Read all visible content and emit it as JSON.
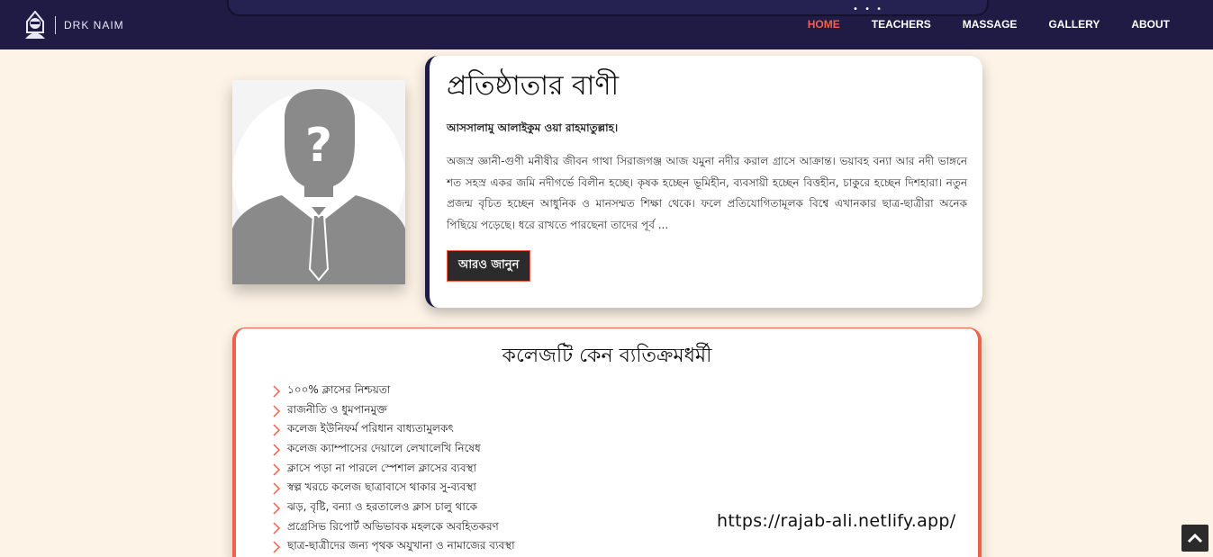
{
  "brand": {
    "name": "DRK NAIM",
    "icon": "hacker-icon"
  },
  "nav": {
    "dots": "• • •",
    "items": [
      {
        "label": "HOME",
        "active": true
      },
      {
        "label": "TEACHERS",
        "active": false
      },
      {
        "label": "MASSAGE",
        "active": false
      },
      {
        "label": "GALLERY",
        "active": false
      },
      {
        "label": "ABOUT",
        "active": false
      }
    ]
  },
  "founder": {
    "title": "প্রতিষ্ঠাতার বাণী",
    "greeting": "আসসালামু আলাইকুম ওয়া রাহমাতুল্লাহ।",
    "body": "অজস্র জ্ঞানী-গুণী মনীষীর জীবন গাথা সিরাজগঞ্জ আজ যমুনা নদীর করাল গ্রাসে আক্রান্ত। ভয়াবহ বন্যা আর নদী ভাঙ্গনে শত সহস্র একর জমি নদীগর্ভে বিলীন হচ্ছে। কৃষক হচ্ছেন ভূমিহীন, ব্যবসায়ী হচ্ছেন বিত্তহীন, চাকুরে হচ্ছেন দিশহারা। নতুন প্রজন্ম বৃচিত হচ্ছেন আধুনিক ও মানসম্মত শিক্ষা থেকে। ফলে প্রতিযোগিতামূলক বিশ্বে এখানকার ছাত্র-ছাত্রীরা অনেক পিছিয়ে পড়েছে। ধরে রাখতে পারছেনা তাদের পূর্ব ...",
    "button_label": "আরও জানুন",
    "photo": "anonymous-person-icon"
  },
  "why": {
    "title": "কলেজটি কেন ব্যতিক্রমধর্মী",
    "items": [
      "১০০% ক্লাসের নিশ্চয়তা",
      "রাজনীতি ও ধুমপানমুক্ত",
      "কলেজ ইউনিফর্ম পরিধান বাধ্যতামুলকৎ",
      "কলেজ ক্যাম্পাসের দেয়ালে লেখালেখি নিষেধ",
      "ক্লাসে পড়া না পারলে স্পেশাল ক্লাসের ব্যবস্থা",
      "স্বল্প খরচে কলেজ ছাত্রাবাসে থাকার সু-ব্যবস্থা",
      "ঝড়, বৃষ্টি, বন্যা ও হরতালেও ক্লাস চালু থাকে",
      "প্রগ্রেসিভ রিপোর্ট অভিভাবক মহলকে অবহিতকরণ",
      "ছাত্র-ছাত্রীদের জন্য পৃথক অযুখানা ও নামাজের ব্যবস্থা"
    ]
  },
  "watermark": "https://rajab-ali.netlify.app/",
  "back_to_top_icon": "chevron-up-icon",
  "colors": {
    "nav_bg": "#1f1b45",
    "accent": "#f0604a",
    "page_bg": "#fdf3e6"
  }
}
